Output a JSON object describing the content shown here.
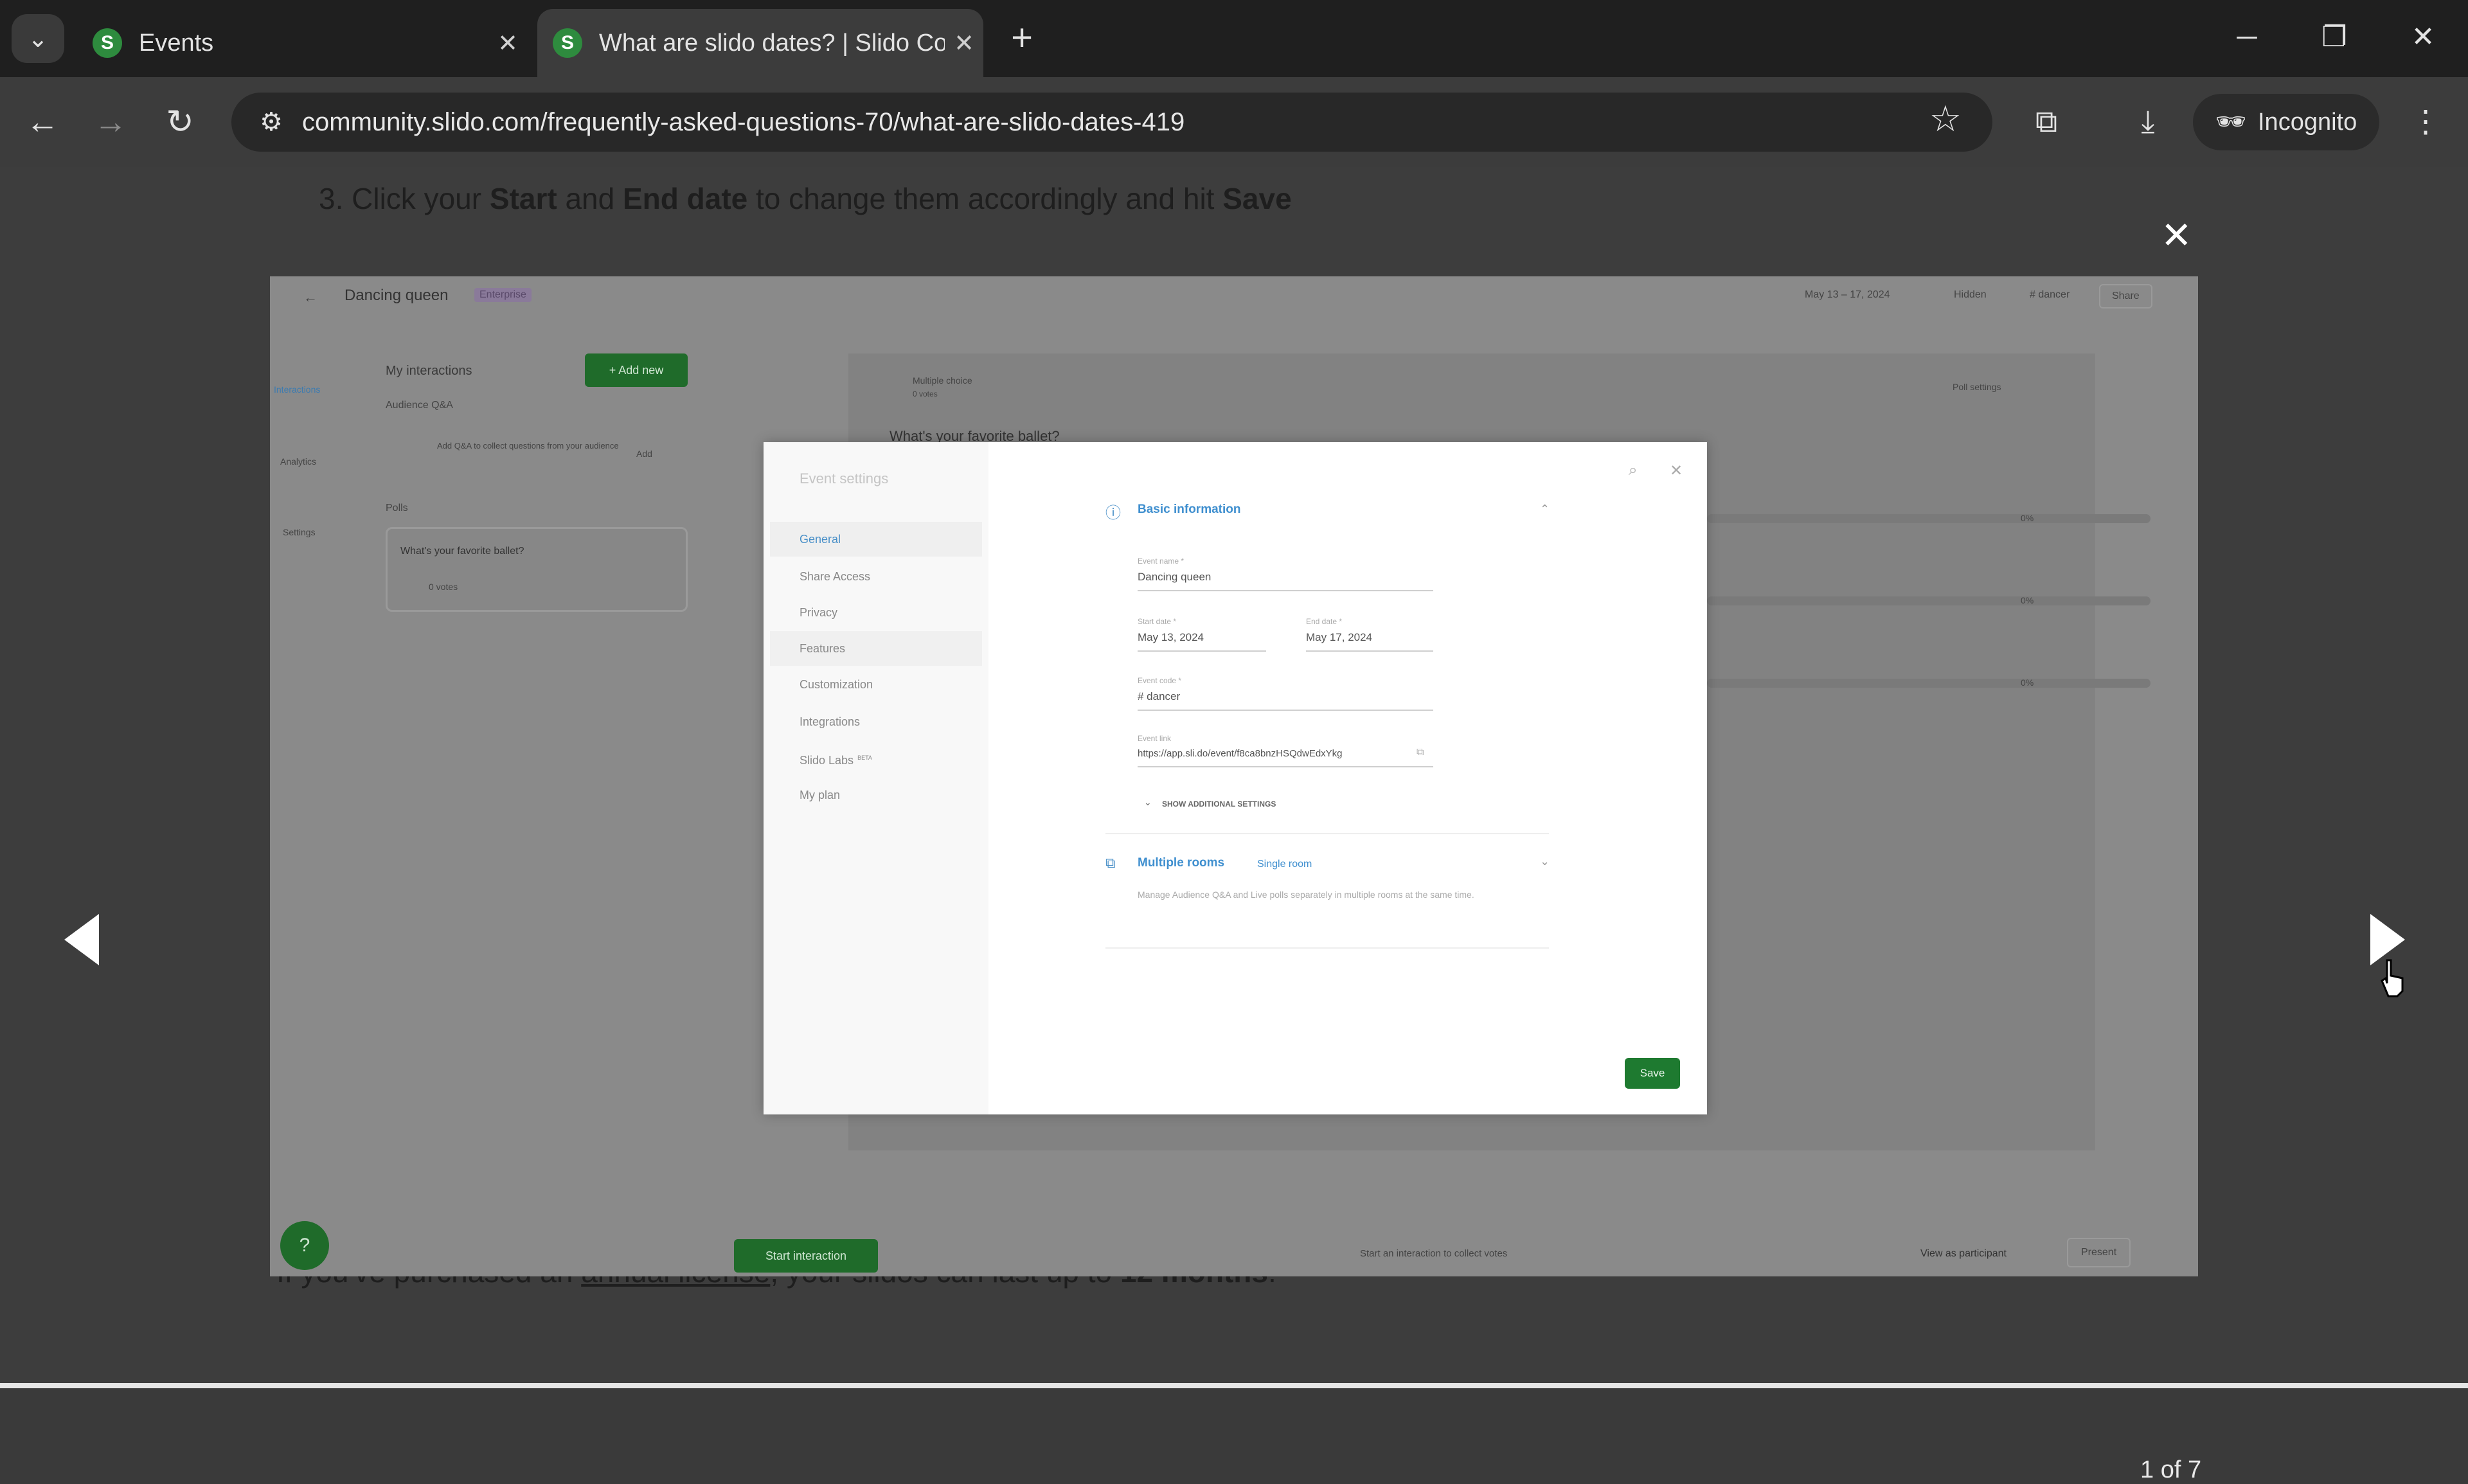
{
  "browser": {
    "tabs": [
      {
        "title": "Events",
        "favicon": "S"
      },
      {
        "title": "What are slido dates? | Slido Co",
        "favicon": "S"
      }
    ],
    "url": "community.slido.com/frequently-asked-questions-70/what-are-slido-dates-419",
    "incognito_label": "Incognito"
  },
  "article": {
    "step_prefix": "3. Click your ",
    "step_bold1": "Start",
    "step_mid1": " and ",
    "step_bold2": "End date",
    "step_mid2": " to change them accordingly and hit ",
    "step_bold3": "Save",
    "footer_prefix": "If you've purchased an ",
    "footer_link": "annual license",
    "footer_mid": ", your slidos can last up to ",
    "footer_bold": "12 months",
    "footer_suffix": "."
  },
  "lightbox": {
    "counter": "1 of 7"
  },
  "screenshot": {
    "event_name": "Dancing queen",
    "plan_badge": "Enterprise",
    "header_date": "May 13 – 17, 2024",
    "header_hidden": "Hidden",
    "header_code": "# dancer",
    "share_label": "Share",
    "left_nav": [
      "Interactions",
      "Analytics",
      "Settings"
    ],
    "my_interactions": "My interactions",
    "add_new": "+ Add new",
    "audience_qa": "Audience Q&A",
    "qa_hint": "Add Q&A to collect questions from your audience",
    "qa_add": "Add",
    "polls": "Polls",
    "poll_question": "What's your favorite ballet?",
    "poll_votes": "0 votes",
    "poll_type": "Multiple choice",
    "poll_type_votes": "0 votes",
    "poll_settings": "Poll settings",
    "poll_title": "What's your favorite ballet?",
    "percents": [
      "0%",
      "0%",
      "0%"
    ],
    "start_interaction": "Start interaction",
    "bottom_hint": "Start an interaction to collect votes",
    "view_as_participant": "View as participant",
    "present": "Present"
  },
  "modal": {
    "title": "Event settings",
    "menu": [
      "General",
      "Share Access",
      "Privacy",
      "Features",
      "Customization",
      "Integrations",
      "Slido Labs",
      "My plan"
    ],
    "labs_badge": "BETA",
    "basic_info": "Basic information",
    "event_name_label": "Event name *",
    "event_name_value": "Dancing queen",
    "start_label": "Start date *",
    "start_value": "May 13, 2024",
    "end_label": "End date *",
    "end_value": "May 17, 2024",
    "code_label": "Event code *",
    "code_value": "# dancer",
    "link_label": "Event link",
    "link_value": "https://app.sli.do/event/f8ca8bnzHSQdwEdxYkg",
    "show_additional": "SHOW ADDITIONAL SETTINGS",
    "multiple_rooms": "Multiple rooms",
    "single_room": "Single room",
    "rooms_desc": "Manage Audience Q&A and Live polls separately in multiple rooms at the same time.",
    "save": "Save"
  }
}
